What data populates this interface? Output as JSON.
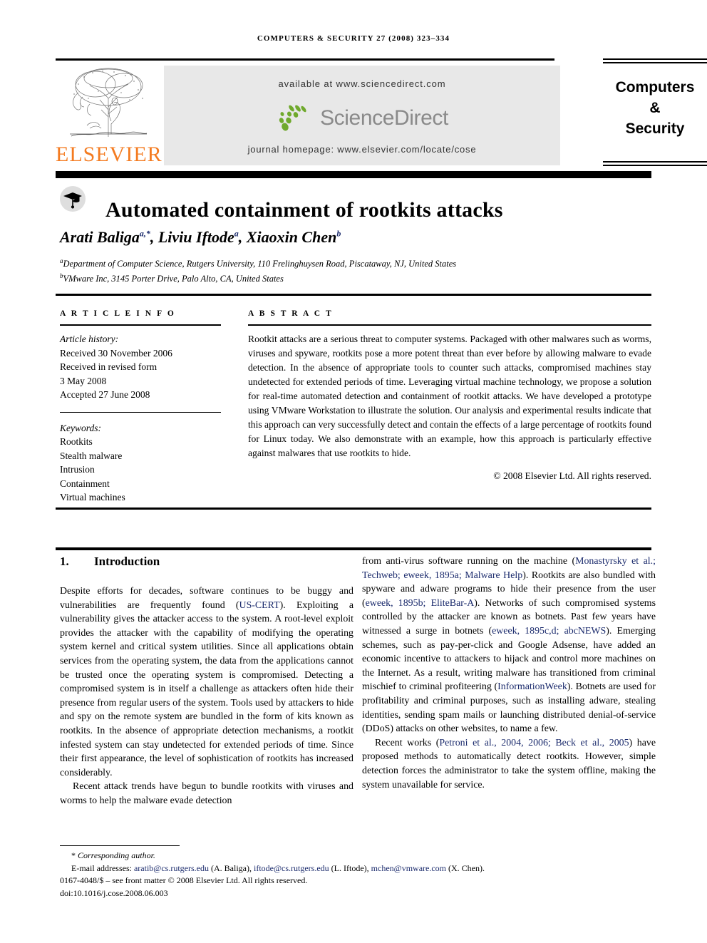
{
  "running_head": "Computers & security 27 (2008) 323–334",
  "masthead": {
    "available_at": "available at www.sciencedirect.com",
    "sciencedirect_wordmark": "ScienceDirect",
    "journal_homepage": "journal homepage: www.elsevier.com/locate/cose",
    "publisher_name": "ELSEVIER",
    "journal_title_line1": "Computers",
    "journal_title_line2": "&",
    "journal_title_line3": "Security",
    "colors": {
      "elsevier_orange": "#F47B20",
      "sciencedirect_green": "#6FA92C",
      "sciencedirect_gray": "#8a8a8a",
      "panel_gray": "#e8e8e8",
      "citation_blue": "#1a2a6c"
    }
  },
  "article": {
    "title": "Automated containment of rootkits attacks",
    "authors_html": "Arati Baliga<sup>a,*</sup>, Liviu Iftode<sup>a</sup>, Xiaoxin Chen<sup>b</sup>",
    "affiliation_a": "Department of Computer Science, Rutgers University, 110 Frelinghuysen Road, Piscataway, NJ, United States",
    "affiliation_b": "VMware Inc, 3145 Porter Drive, Palo Alto, CA, United States"
  },
  "article_info": {
    "heading": "A R T I C L E   I N F O",
    "history_label": "Article history:",
    "history_lines": [
      "Received 30 November 2006",
      "Received in revised form",
      "3 May 2008",
      "Accepted 27 June 2008"
    ],
    "keywords_label": "Keywords:",
    "keywords": [
      "Rootkits",
      "Stealth malware",
      "Intrusion",
      "Containment",
      "Virtual machines"
    ]
  },
  "abstract": {
    "heading": "A B S T R A C T",
    "text": "Rootkit attacks are a serious threat to computer systems. Packaged with other malwares such as worms, viruses and spyware, rootkits pose a more potent threat than ever before by allowing malware to evade detection. In the absence of appropriate tools to counter such attacks, compromised machines stay undetected for extended periods of time. Leveraging virtual machine technology, we propose a solution for real-time automated detection and containment of rootkit attacks. We have developed a prototype using VMware Workstation to illustrate the solution. Our analysis and experimental results indicate that this approach can very successfully detect and contain the effects of a large percentage of rootkits found for Linux today. We also demonstrate with an example, how this approach is particularly effective against malwares that use rootkits to hide.",
    "copyright": "© 2008 Elsevier Ltd. All rights reserved."
  },
  "body": {
    "section_number": "1.",
    "section_title": "Introduction",
    "left_paragraph_1_parts": [
      {
        "t": "Despite efforts for decades, software continues to be buggy and vulnerabilities are frequently found ("
      },
      {
        "t": "US-CERT",
        "cite": true
      },
      {
        "t": "). Exploiting a vulnerability gives the attacker access to the system. A root-level exploit provides the attacker with the capability of modifying the operating system kernel and critical system utilities. Since all applications obtain services from the operating system, the data from the applications cannot be trusted once the operating system is compromised. Detecting a compromised system is in itself a challenge as attackers often hide their presence from regular users of the system. Tools used by attackers to hide and spy on the remote system are bundled in the form of kits known as rootkits. In the absence of appropriate detection mechanisms, a rootkit infested system can stay undetected for extended periods of time. Since their first appearance, the level of sophistication of rootkits has increased considerably."
      }
    ],
    "left_paragraph_2_parts": [
      {
        "t": "Recent attack trends have begun to bundle rootkits with viruses and worms to help the malware evade detection"
      }
    ],
    "right_paragraph_1_parts": [
      {
        "t": "from anti-virus software running on the machine ("
      },
      {
        "t": "Monastyrsky et al.; Techweb; eweek, 1895a; Malware Help",
        "cite": true
      },
      {
        "t": "). Rootkits are also bundled with spyware and adware programs to hide their presence from the user ("
      },
      {
        "t": "eweek, 1895b; EliteBar-A",
        "cite": true
      },
      {
        "t": "). Networks of such compromised systems controlled by the attacker are known as botnets. Past few years have witnessed a surge in botnets ("
      },
      {
        "t": "eweek, 1895c,d; abcNEWS",
        "cite": true
      },
      {
        "t": "). Emerging schemes, such as pay-per-click and Google Adsense, have added an economic incentive to attackers to hijack and control more machines on the Internet. As a result, writing malware has transitioned from criminal mischief to criminal profiteering ("
      },
      {
        "t": "InformationWeek",
        "cite": true
      },
      {
        "t": "). Botnets are used for profitability and criminal purposes, such as installing adware, stealing identities, sending spam mails or launching distributed denial-of-service (DDoS) attacks on other websites, to name a few."
      }
    ],
    "right_paragraph_2_parts": [
      {
        "t": "Recent works ("
      },
      {
        "t": "Petroni et al., 2004, 2006; Beck et al., 2005",
        "cite": true
      },
      {
        "t": ") have proposed methods to automatically detect rootkits. However, simple detection forces the administrator to take the system offline, making the system unavailable for service."
      }
    ]
  },
  "footnote": {
    "corresponding_marker": "*",
    "corresponding_label": "Corresponding author.",
    "email_label": "E-mail addresses:",
    "emails": [
      {
        "address": "aratib@cs.rutgers.edu",
        "who": "(A. Baliga)"
      },
      {
        "address": "iftode@cs.rutgers.edu",
        "who": "(L. Iftode)"
      },
      {
        "address": "mchen@vmware.com",
        "who": "(X. Chen)"
      }
    ],
    "issn_line": "0167-4048/$ – see front matter © 2008 Elsevier Ltd. All rights reserved.",
    "doi_line": "doi:10.1016/j.cose.2008.06.003"
  }
}
